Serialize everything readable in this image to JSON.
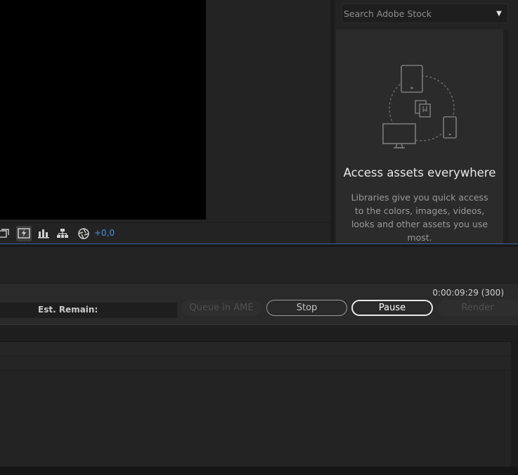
{
  "viewer": {
    "exposure_value": "+0,0"
  },
  "libraries": {
    "search_placeholder": "Search Adobe Stock",
    "empty_title": "Access assets everywhere",
    "empty_description": "Libraries give you quick access to the colors, images, videos, looks and other assets you use most."
  },
  "render_queue": {
    "elapsed_time": "0:00:09:29 (300)",
    "est_remain_label": "Est. Remain:",
    "queue_in_ame_label": "Queue in AME",
    "stop_label": "Stop",
    "pause_label": "Pause",
    "render_label": "Render"
  },
  "colors": {
    "accent_blue": "#4a90e2",
    "panel_bg": "#232323",
    "canvas": "#000000"
  },
  "icons": {
    "toolbar": [
      "region-of-interest-icon",
      "fast-previews-icon",
      "transparency-grid-icon",
      "flowchart-icon",
      "exposure-reset-icon"
    ],
    "libraries": [
      "devices-sync-illustration"
    ],
    "dropdown": "chevron-down-icon"
  }
}
